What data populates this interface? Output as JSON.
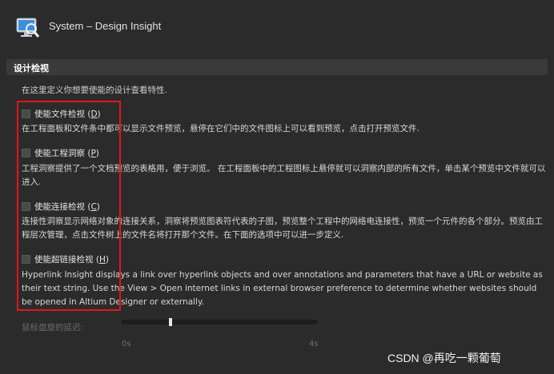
{
  "header": {
    "title": "System – Design Insight",
    "icon": "design-insight-icon"
  },
  "section": {
    "title": "设计检视"
  },
  "intro": "在这里定义你想要使能的设计查看特性.",
  "options": [
    {
      "label": "使能文件检视",
      "hotkey": "D",
      "checked": false,
      "desc": "在工程面板和文件条中都可以显示文件预览，悬停在它们中的文件图标上可以看到预览，点击打开预览文件."
    },
    {
      "label": "使能工程洞察",
      "hotkey": "P",
      "checked": false,
      "desc": "工程洞察提供了一个文档预览的表格用，便于浏览。 在工程面板中的工程图标上悬停就可以洞察内部的所有文件，单击某个预览中文件就可以进入."
    },
    {
      "label": "使能连接检视",
      "hotkey": "C",
      "checked": false,
      "desc": "连接性洞察显示网络对象的连接关系，洞察将预览图表符代表的子图，预览整个工程中的网络电连接性，预览一个元件的各个部分。预览由工程层次管理，点击文件树上的文件名将打开那个文件。在下面的选项中可以进一步定义."
    },
    {
      "label": "使能超链接检视",
      "hotkey": "H",
      "checked": false,
      "desc": "Hyperlink Insight displays a link over hyperlink objects and over annotations and parameters that have a URL or website as their text string. Use the View > Open internet links in external browser preference to determine whether websites should be opened in Altium Designer or externally."
    }
  ],
  "slider": {
    "label": "鼠标盘旋的延迟:",
    "min_label": "0s",
    "max_label": "4s",
    "value_fraction": 0.25
  },
  "watermark": "CSDN @再吃一颗葡萄",
  "colors": {
    "highlight": "#e0161c",
    "background": "#2b2b2b",
    "section_bar": "#3a3a3a"
  }
}
